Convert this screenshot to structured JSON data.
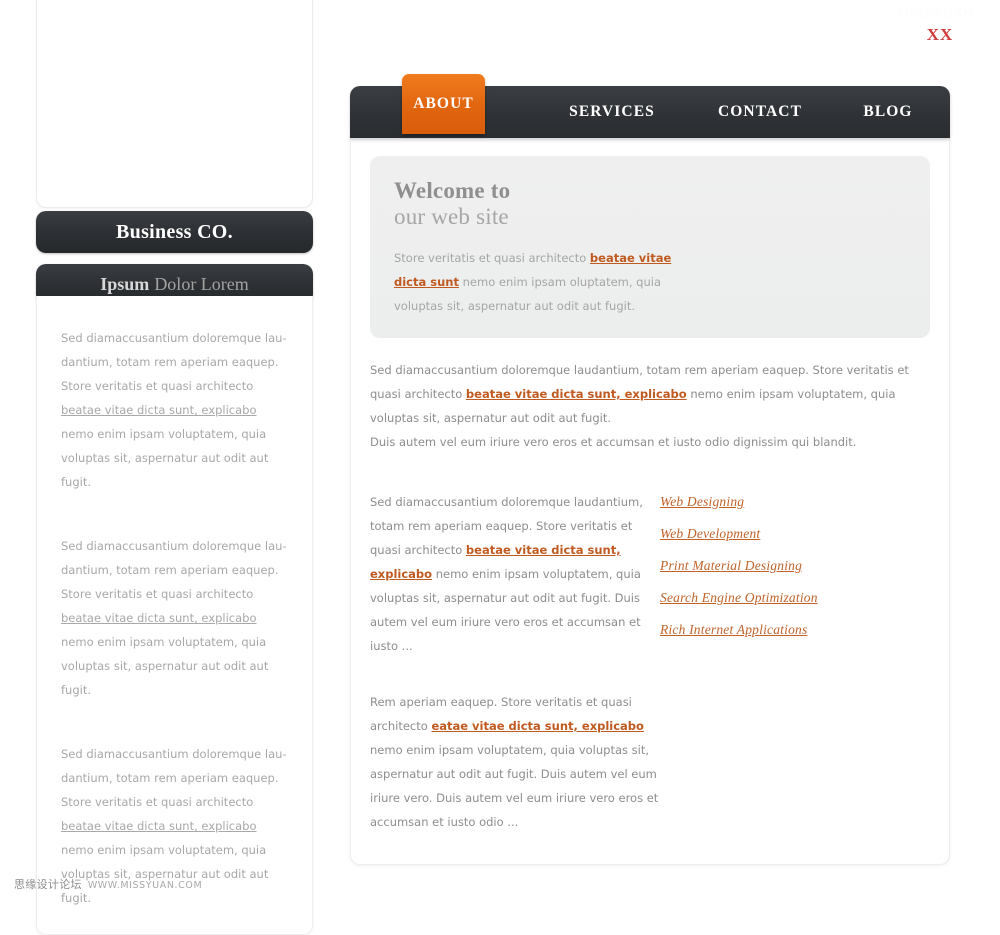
{
  "page": {
    "top_watermark": "MISSYUAN",
    "xx_mark": "XX"
  },
  "sidebar": {
    "brand_title": "Business CO.",
    "section_title_strong": "Ipsum",
    "section_title_light": "Dolor Lorem",
    "paragraphs": [
      {
        "before": "Sed diamaccusantium doloremque lau-dantium, totam rem aperiam eaquep. Store veritatis et quasi architecto ",
        "link": "beatae vitae dicta sunt, explicabo",
        "after": " nemo enim ipsam voluptatem, quia voluptas sit, aspernatur aut odit aut fugit."
      },
      {
        "before": "Sed diamaccusantium doloremque lau-dantium, totam rem aperiam eaquep. Store veritatis et quasi architecto ",
        "link": "beatae vitae dicta sunt, explicabo",
        "after": " nemo enim ipsam voluptatem, quia voluptas sit, aspernatur aut odit aut fugit."
      },
      {
        "before": "Sed diamaccusantium doloremque lau-dantium, totam rem aperiam eaquep. Store veritatis et quasi architecto ",
        "link": "beatae vitae dicta sunt, explicabo",
        "after": " nemo enim ipsam voluptatem, quia voluptas sit, aspernatur aut odit aut fugit."
      }
    ]
  },
  "nav": {
    "items": [
      {
        "label": "ABOUT",
        "active": true
      },
      {
        "label": "SERVICES",
        "active": false
      },
      {
        "label": "CONTACT",
        "active": false
      },
      {
        "label": "BLOG",
        "active": false
      }
    ]
  },
  "hero": {
    "title_line1": "Welcome to",
    "title_line2": "our web site",
    "text_before": "Store veritatis et quasi architecto ",
    "text_link": "beatae vitae dicta sunt",
    "text_after": " nemo enim ipsam oluptatem, quia voluptas sit, aspernatur aut odit aut fugit."
  },
  "intro": {
    "p1_before": "Sed diamaccusantium doloremque laudantium, totam rem aperiam eaquep. Store veritatis et quasi architecto ",
    "p1_link": "beatae vitae dicta sunt, explicabo",
    "p1_after": " nemo enim ipsam voluptatem, quia voluptas sit, aspernatur aut odit aut fugit.",
    "p2": "Duis autem vel eum iriure vero eros et accumsan et iusto odio dignissim qui blandit."
  },
  "column_left": {
    "before": "Sed diamaccusantium doloremque laudantium, totam rem aperiam eaquep. Store veritatis et quasi architecto ",
    "link": "beatae vitae dicta sunt, explicabo",
    "after": " nemo enim ipsam voluptatem, quia voluptas sit, aspernatur aut odit aut fugit. Duis autem vel eum iriure vero eros et accumsan et iusto ..."
  },
  "services_links": [
    "Web Designing",
    "Web Development",
    "Print Material Designing",
    "Search Engine Optimization",
    "Rich Internet Applications"
  ],
  "bottom_paragraph": {
    "before": "Rem aperiam eaquep. Store veritatis et quasi architecto ",
    "link": "eatae vitae dicta sunt, explicabo",
    "after": " nemo enim ipsam voluptatem, quia voluptas sit, aspernatur aut odit aut fugit. Duis autem vel eum iriure vero. Duis autem vel eum iriure vero eros et accumsan et iusto odio ..."
  },
  "footer": {
    "cn_text": "思缘设计论坛",
    "url_text": "WWW.MISSYUAN.COM"
  },
  "colors": {
    "accent_orange": "#e8761c",
    "link_orange": "#c05a20",
    "dark_bar": "#2f3236",
    "hero_bg": "#eeefee",
    "xx_red": "#cf3b3b"
  }
}
